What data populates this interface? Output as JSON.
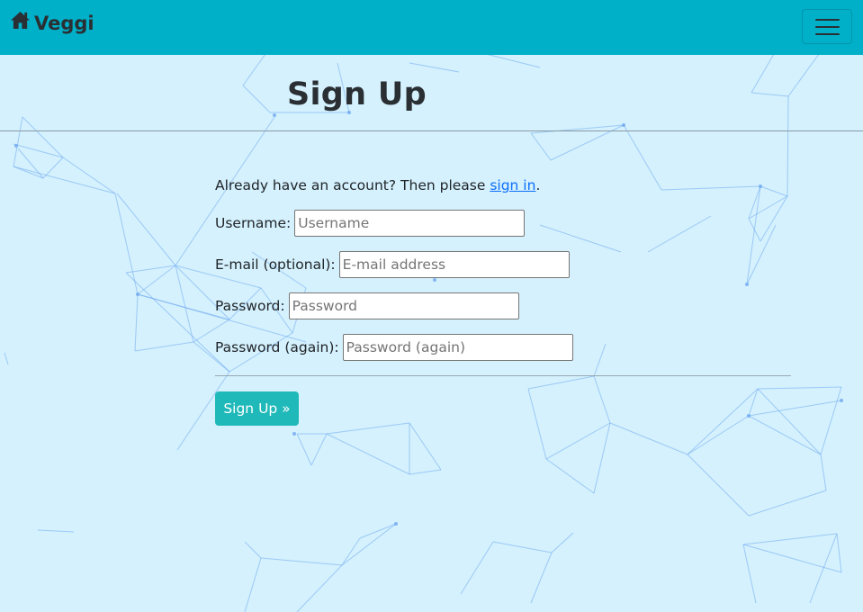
{
  "navbar": {
    "brand_label": "Veggi",
    "brand_icon": "home-icon",
    "menu_icon": "hamburger-menu-icon",
    "background_color": "#00b0c8"
  },
  "page": {
    "title": "Sign Up",
    "intro_text": "Already have an account? Then please ",
    "sign_in_link": "sign in",
    "intro_suffix": "."
  },
  "form": {
    "username": {
      "label": "Username:",
      "placeholder": "Username",
      "value": ""
    },
    "email": {
      "label": "E-mail (optional):",
      "placeholder": "E-mail address",
      "value": ""
    },
    "password": {
      "label": "Password:",
      "placeholder": "Password",
      "value": ""
    },
    "password2": {
      "label": "Password (again):",
      "placeholder": "Password (again)",
      "value": ""
    },
    "submit_label": "Sign Up »"
  },
  "colors": {
    "page_background": "#d4f1fd",
    "button": "#20b9b9",
    "network_lines": "#6fa8f0"
  }
}
